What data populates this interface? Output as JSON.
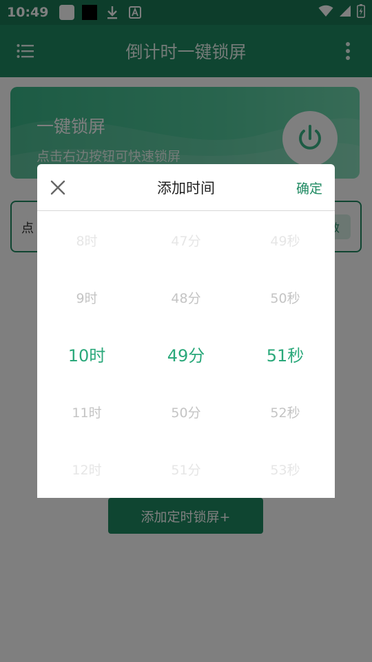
{
  "status_bar": {
    "time": "10:49",
    "icons": [
      "square-notification-icon",
      "black-square-notification-icon",
      "download-icon",
      "text-a-icon",
      "wifi-icon",
      "signal-icon",
      "battery-charging-icon"
    ]
  },
  "toolbar": {
    "title": "倒计时一键锁屏"
  },
  "hero": {
    "title": "一键锁屏",
    "subtitle": "点击右边按钮可快速锁屏"
  },
  "info_box": {
    "text_fragment": "点",
    "chip_fragment": "效"
  },
  "add_button": {
    "label": "添加定时锁屏+"
  },
  "dialog": {
    "title": "添加时间",
    "confirm_label": "确定",
    "hours": [
      "8时",
      "9时",
      "10时",
      "11时",
      "12时"
    ],
    "minutes": [
      "47分",
      "48分",
      "49分",
      "50分",
      "51分"
    ],
    "seconds": [
      "49秒",
      "50秒",
      "51秒",
      "52秒",
      "53秒"
    ]
  },
  "colors": {
    "primary": "#1f8a62",
    "status_bar": "#1a7a56",
    "selected_text": "#2aa87a",
    "hero_gradient_start": "#3ab789",
    "hero_gradient_end": "#6fd7ae"
  }
}
